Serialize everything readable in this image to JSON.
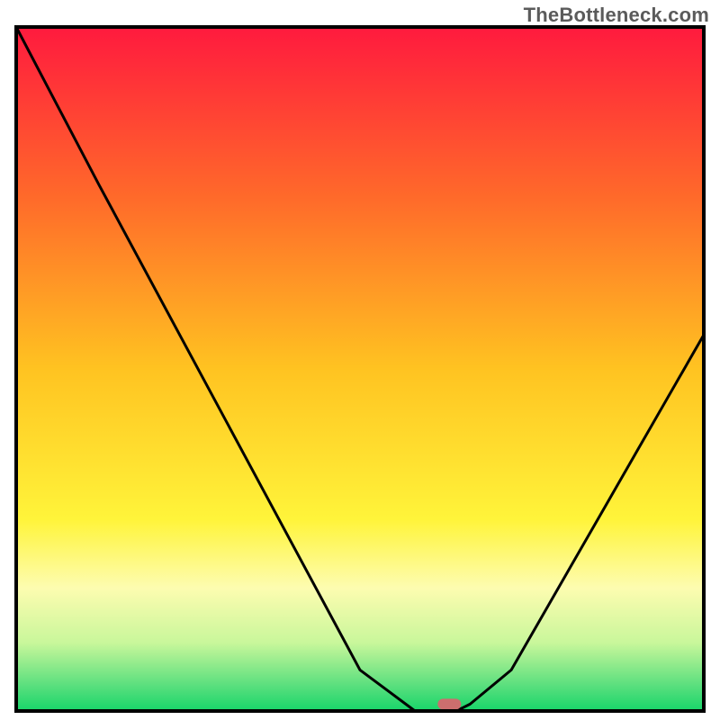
{
  "watermark": "TheBottleneck.com",
  "chart_data": {
    "type": "line",
    "title": "",
    "xlabel": "",
    "ylabel": "",
    "ylim": [
      0,
      100
    ],
    "xlim": [
      0,
      100
    ],
    "x": [
      0,
      12,
      50,
      58,
      64,
      66,
      72,
      100
    ],
    "values": [
      100,
      77,
      6,
      0,
      0,
      1,
      6,
      55
    ],
    "flat_region_x": [
      58,
      64
    ],
    "marker": {
      "x": 63,
      "y": 1
    },
    "gradient_stops": [
      {
        "offset": 0.0,
        "color": "#ff1a3e"
      },
      {
        "offset": 0.25,
        "color": "#ff6a2a"
      },
      {
        "offset": 0.5,
        "color": "#ffc321"
      },
      {
        "offset": 0.72,
        "color": "#fff43a"
      },
      {
        "offset": 0.82,
        "color": "#fdfcb0"
      },
      {
        "offset": 0.9,
        "color": "#c9f79b"
      },
      {
        "offset": 0.96,
        "color": "#5fe07f"
      },
      {
        "offset": 1.0,
        "color": "#17d56a"
      }
    ],
    "frame_color": "#000000",
    "line_color": "#000000",
    "marker_color": "#cc6e6e"
  }
}
